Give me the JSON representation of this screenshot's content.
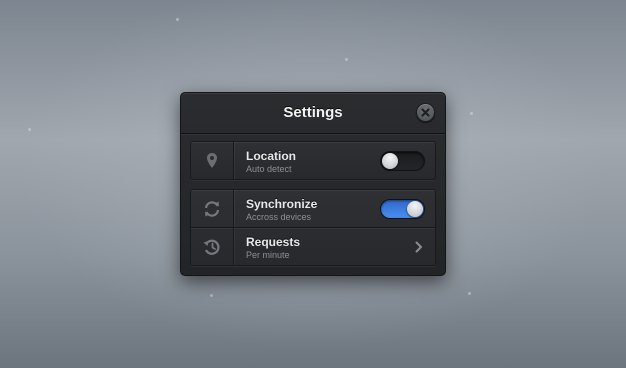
{
  "window": {
    "title": "Settings",
    "close_icon": "close-icon"
  },
  "settings": [
    {
      "icon": "location-pin-icon",
      "label": "Location",
      "sublabel": "Auto detect",
      "control": "toggle",
      "on": false
    },
    {
      "icon": "sync-icon",
      "label": "Synchronize",
      "sublabel": "Accross devices",
      "control": "toggle",
      "on": true
    },
    {
      "icon": "history-icon",
      "label": "Requests",
      "sublabel": "Per minute",
      "control": "chevron"
    }
  ],
  "colors": {
    "accent": "#4a8cf0",
    "panel": "#26282b"
  }
}
